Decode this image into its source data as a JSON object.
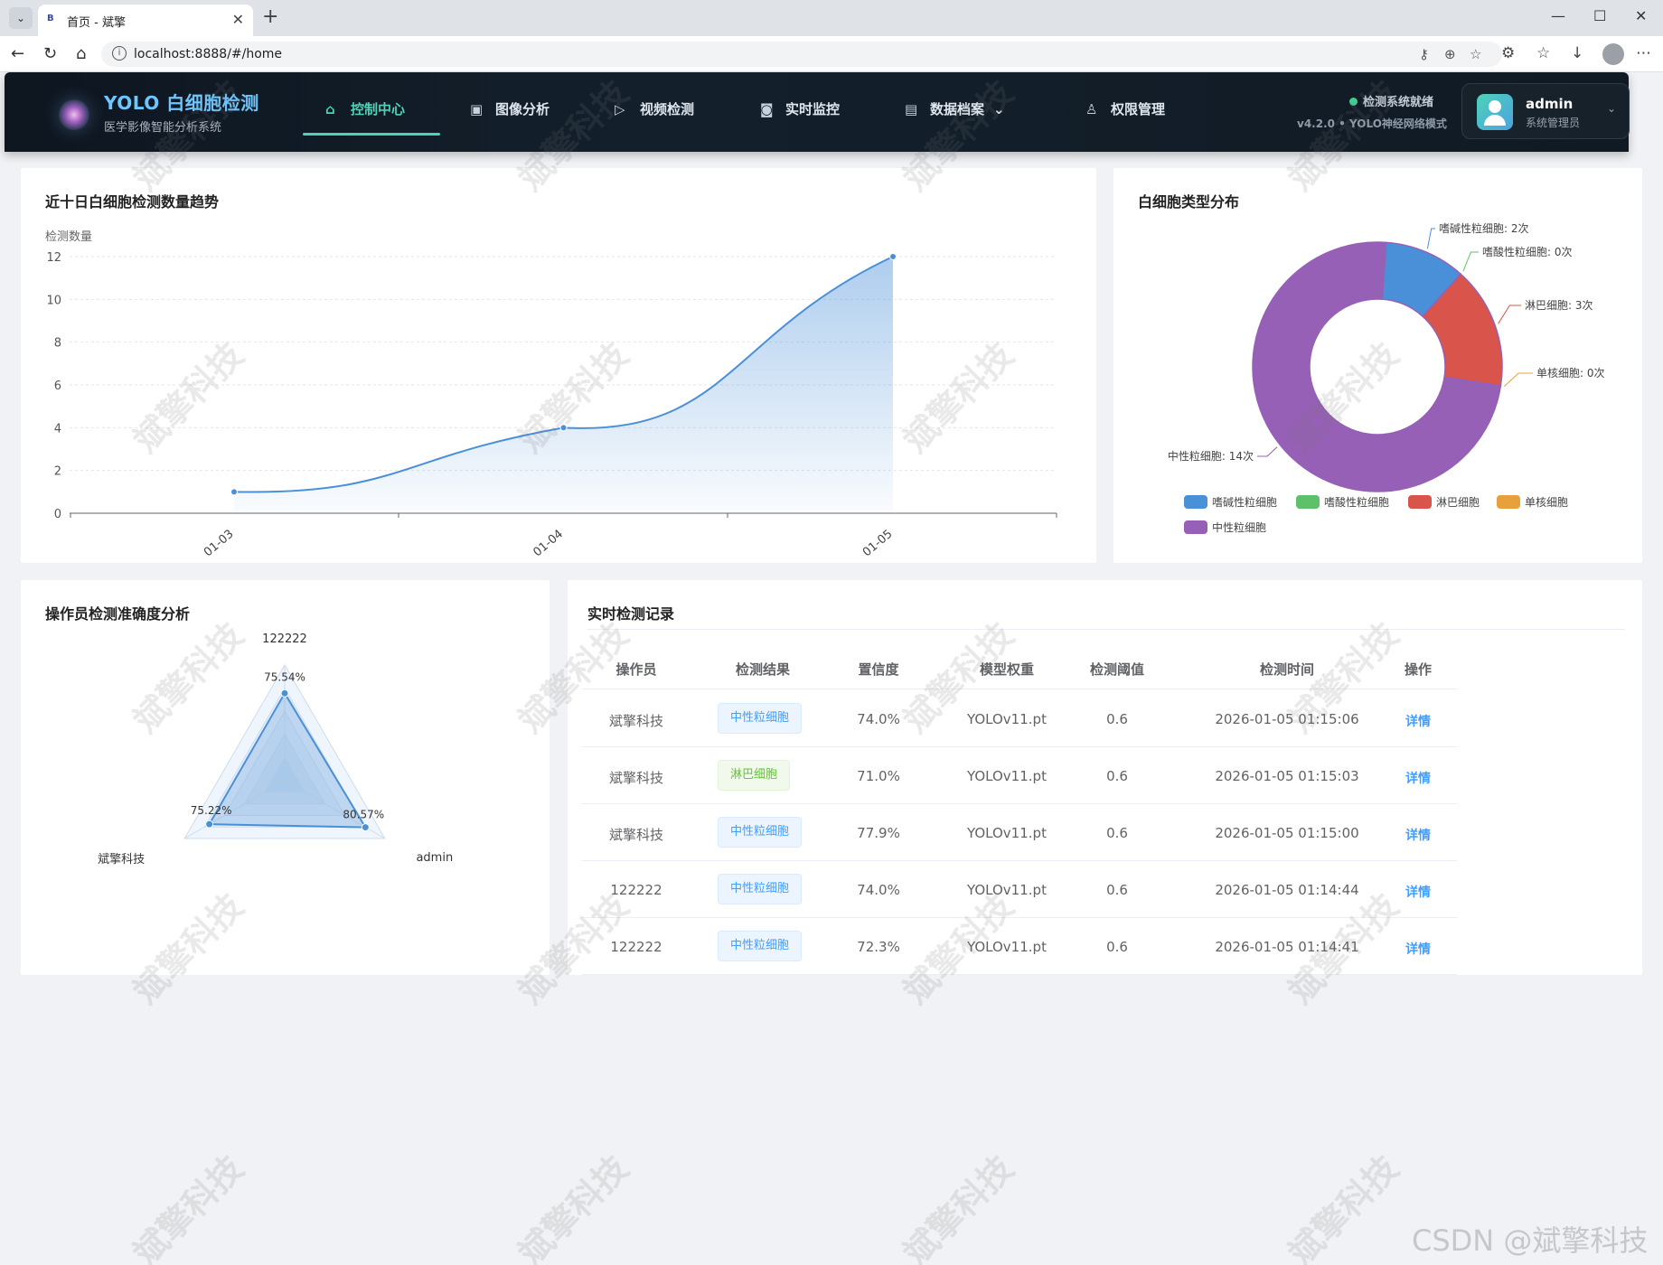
{
  "browser": {
    "tab_title": "首页 - 斌擎",
    "favicon": "B",
    "url": "localhost:8888/#/home"
  },
  "header": {
    "logo_title": "YOLO 白细胞检测",
    "logo_subtitle": "医学影像智能分析系统",
    "nav": [
      {
        "label": "控制中心",
        "icon": "home-icon"
      },
      {
        "label": "图像分析",
        "icon": "image-icon"
      },
      {
        "label": "视频检测",
        "icon": "play-circle-icon"
      },
      {
        "label": "实时监控",
        "icon": "camera-icon"
      },
      {
        "label": "数据档案",
        "icon": "document-icon"
      },
      {
        "label": "权限管理",
        "icon": "user-icon"
      }
    ],
    "status": "检测系统就绪",
    "version": "v4.2.0 • YOLO神经网络模式",
    "user_name": "admin",
    "user_role": "系统管理员",
    "accent": "#4fd1b8"
  },
  "trend": {
    "title": "近十日白细胞检测数量趋势",
    "y_name": "检测数量"
  },
  "pie": {
    "title": "白细胞类型分布"
  },
  "radar": {
    "title": "操作员检测准确度分析"
  },
  "records": {
    "title": "实时检测记录",
    "columns": [
      "操作员",
      "检测结果",
      "置信度",
      "模型权重",
      "检测阈值",
      "检测时间",
      "操作"
    ],
    "rows": [
      {
        "operator": "斌擎科技",
        "result": "中性粒细胞",
        "tag": "blue",
        "confidence": "74.0%",
        "model": "YOLOv11.pt",
        "threshold": "0.6",
        "time": "2026-01-05 01:15:06",
        "action": "详情"
      },
      {
        "operator": "斌擎科技",
        "result": "淋巴细胞",
        "tag": "green",
        "confidence": "71.0%",
        "model": "YOLOv11.pt",
        "threshold": "0.6",
        "time": "2026-01-05 01:15:03",
        "action": "详情"
      },
      {
        "operator": "斌擎科技",
        "result": "中性粒细胞",
        "tag": "blue",
        "confidence": "77.9%",
        "model": "YOLOv11.pt",
        "threshold": "0.6",
        "time": "2026-01-05 01:15:00",
        "action": "详情"
      },
      {
        "operator": "122222",
        "result": "中性粒细胞",
        "tag": "blue",
        "confidence": "74.0%",
        "model": "YOLOv11.pt",
        "threshold": "0.6",
        "time": "2026-01-05 01:14:44",
        "action": "详情"
      },
      {
        "operator": "122222",
        "result": "中性粒细胞",
        "tag": "blue",
        "confidence": "72.3%",
        "model": "YOLOv11.pt",
        "threshold": "0.6",
        "time": "2026-01-05 01:14:41",
        "action": "详情"
      }
    ]
  },
  "watermark": "斌擎科技",
  "csdn_mark": "CSDN @斌擎科技",
  "chart_data": [
    {
      "type": "area",
      "title": "",
      "ylabel": "检测数量",
      "categories": [
        "01-03",
        "01-04",
        "01-05"
      ],
      "values": [
        1,
        4,
        12
      ],
      "ylim": [
        0,
        12
      ],
      "yticks": [
        0,
        2,
        4,
        6,
        8,
        10,
        12
      ],
      "color": "#4a90d9",
      "grid": true
    },
    {
      "type": "pie",
      "title": "",
      "donut": true,
      "slices": [
        {
          "name": "嗜碱性粒细胞",
          "value": 2,
          "label": "嗜碱性粒细胞: 2次",
          "color": "#4a90d9"
        },
        {
          "name": "嗜酸性粒细胞",
          "value": 0,
          "label": "嗜酸性粒细胞: 0次",
          "color": "#5ec16a"
        },
        {
          "name": "淋巴细胞",
          "value": 3,
          "label": "淋巴细胞: 3次",
          "color": "#d9544a"
        },
        {
          "name": "单核细胞",
          "value": 0,
          "label": "单核细胞: 0次",
          "color": "#e8a03c"
        },
        {
          "name": "中性粒细胞",
          "value": 14,
          "label": "中性粒细胞: 14次",
          "color": "#9560b5"
        }
      ],
      "legend": "bottom"
    },
    {
      "type": "radar",
      "title": "",
      "indicators": [
        "122222",
        "admin",
        "斌擎科技"
      ],
      "values": [
        75.54,
        80.57,
        75.22
      ],
      "labels": [
        "75.54%",
        "80.57%",
        "75.22%"
      ],
      "max": 100,
      "color": "#4a90d9"
    }
  ]
}
